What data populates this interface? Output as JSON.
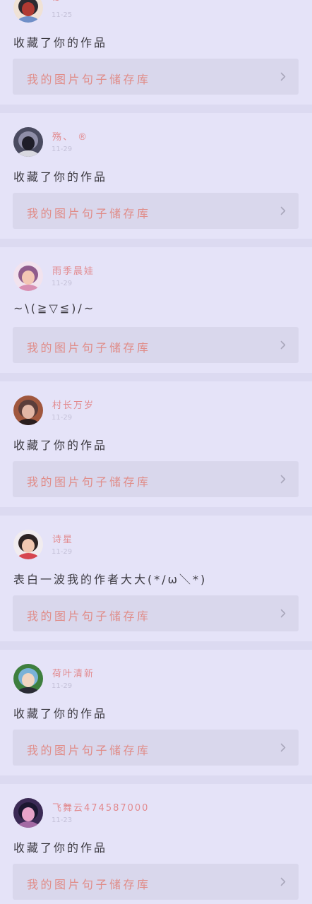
{
  "notifications": [
    {
      "username": "~",
      "date": "11-25",
      "message": "收藏了你的作品",
      "work_title": "我的图片句子储存库",
      "avatar_colors": [
        "#f0e2d6",
        "#6f8fc8",
        "#b03a32",
        "#2b2a30"
      ]
    },
    {
      "username": "殇、 ®",
      "date": "11-29",
      "message": "收藏了你的作品",
      "work_title": "我的图片句子储存库",
      "avatar_colors": [
        "#4a4b60",
        "#d8d8e0",
        "#1e1d28",
        "#8f8ea8"
      ]
    },
    {
      "username": "雨季晨娃",
      "date": "11-29",
      "message": "~\\(≧▽≦)/~",
      "work_title": "我的图片句子储存库",
      "avatar_colors": [
        "#f2e3ee",
        "#d88fb2",
        "#f3c7b4",
        "#8f5c8c"
      ]
    },
    {
      "username": "村长万岁",
      "date": "11-29",
      "message": "收藏了你的作品",
      "work_title": "我的图片句子储存库",
      "avatar_colors": [
        "#a0573e",
        "#2a1e1e",
        "#e3b7a6",
        "#5b3d3a"
      ]
    },
    {
      "username": "诗星",
      "date": "11-29",
      "message": "表白一波我的作者大大(*/ω＼*)",
      "work_title": "我的图片句子储存库",
      "avatar_colors": [
        "#f1ecef",
        "#d6454e",
        "#f1c7b1",
        "#2d2323"
      ]
    },
    {
      "username": "荷叶清新",
      "date": "11-29",
      "message": "收藏了你的作品",
      "work_title": "我的图片句子储存库",
      "avatar_colors": [
        "#3e7f3e",
        "#2a2b35",
        "#f1d5c1",
        "#7ab2d8"
      ]
    },
    {
      "username": "飞舞云474587000",
      "date": "11-23",
      "message": "收藏了你的作品",
      "work_title": "我的图片句子储存库",
      "avatar_colors": [
        "#3b2a55",
        "#a36aa4",
        "#e7a3c9",
        "#1b1730"
      ]
    }
  ]
}
